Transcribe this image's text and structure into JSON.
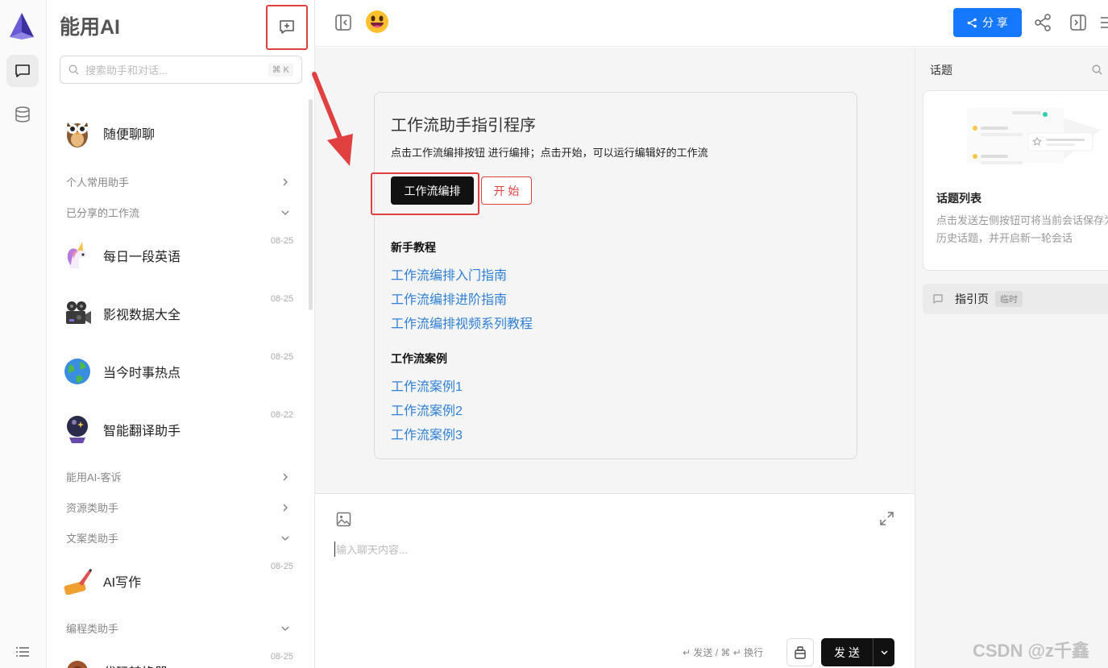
{
  "app": {
    "title": "能用AI",
    "watermark": "CSDN @z千鑫"
  },
  "sidebar": {
    "search_placeholder": "搜索助手和对话...",
    "search_shortcut": "⌘ K",
    "chats": [
      {
        "name": "随便聊聊",
        "date": "",
        "icon": "owl-avatar"
      },
      {
        "name": "每日一段英语",
        "date": "08-25",
        "icon": "unicorn-avatar"
      },
      {
        "name": "影视数据大全",
        "date": "08-25",
        "icon": "movie-camera-avatar"
      },
      {
        "name": "当今时事热点",
        "date": "08-25",
        "icon": "globe-avatar"
      },
      {
        "name": "智能翻译助手",
        "date": "08-22",
        "icon": "crystal-ball-avatar"
      },
      {
        "name": "AI写作",
        "date": "08-25",
        "icon": "writing-hand-avatar"
      },
      {
        "name": "代码转换器",
        "date": "08-25",
        "icon": "gear-avatar"
      }
    ],
    "groups": [
      {
        "label": "个人常用助手",
        "state": "collapsed"
      },
      {
        "label": "已分享的工作流",
        "state": "expanded"
      },
      {
        "label": "能用AI-客诉",
        "state": "collapsed"
      },
      {
        "label": "资源类助手",
        "state": "collapsed"
      },
      {
        "label": "文案类助手",
        "state": "expanded"
      },
      {
        "label": "编程类助手",
        "state": "expanded"
      }
    ]
  },
  "topbar": {
    "share_label": "分 享"
  },
  "main": {
    "card_title": "工作流助手指引程序",
    "card_desc": "点击工作流编排按钮 进行编排；点击开始，可以运行编辑好的工作流",
    "edit_button": "工作流编排",
    "start_button": "开 始",
    "tutorial_heading": "新手教程",
    "tutorials": [
      "工作流编排入门指南",
      "工作流编排进阶指南",
      "工作流编排视频系列教程"
    ],
    "cases_heading": "工作流案例",
    "cases": [
      "工作流案例1",
      "工作流案例2",
      "工作流案例3"
    ]
  },
  "input": {
    "placeholder": "输入聊天内容...",
    "hint": "↵ 发送 / ⌘ ↵ 换行",
    "send_label": "发 送"
  },
  "right_panel": {
    "heading": "话题",
    "card_title": "话题列表",
    "card_desc": "点击发送左侧按钮可将当前会话保存为历史话题，并开启新一轮会话",
    "topic_name": "指引页",
    "topic_tag": "临时"
  },
  "colors": {
    "accent": "#1677ff",
    "annotation": "#e04040",
    "link": "#2f7fd6"
  }
}
